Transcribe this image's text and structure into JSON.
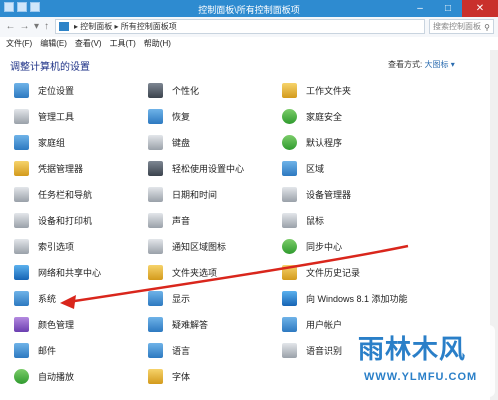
{
  "window": {
    "title": "控制面板\\所有控制面板项"
  },
  "address": {
    "path": "▸ 控制面板 ▸ 所有控制面板项",
    "search_placeholder": "搜索控制面板"
  },
  "menu": [
    "文件(F)",
    "编辑(E)",
    "查看(V)",
    "工具(T)",
    "帮助(H)"
  ],
  "header": {
    "title": "调整计算机的设置",
    "view_label": "查看方式:",
    "view_value": "大图标 ▾"
  },
  "columns": [
    [
      "定位设置",
      "管理工具",
      "家庭组",
      "凭据管理器",
      "任务栏和导航",
      "设备和打印机",
      "索引选项",
      "网络和共享中心",
      "系统",
      "颜色管理",
      "邮件",
      "自动播放"
    ],
    [
      "个性化",
      "恢复",
      "键盘",
      "轻松使用设置中心",
      "日期和时间",
      "声音",
      "通知区域图标",
      "文件夹选项",
      "显示",
      "疑难解答",
      "语言",
      "字体"
    ],
    [
      "工作文件夹",
      "家庭安全",
      "默认程序",
      "区域",
      "设备管理器",
      "鼠标",
      "同步中心",
      "文件历史记录",
      "向 Windows 8.1 添加功能",
      "用户帐户",
      "语音识别"
    ]
  ],
  "watermark": {
    "logo": "雨林木风",
    "url": "WWW.YLMFU.COM"
  },
  "colors": {
    "titlebar": "#2e8bd0",
    "heading": "#1e3287",
    "arrow": "#d9261c"
  }
}
